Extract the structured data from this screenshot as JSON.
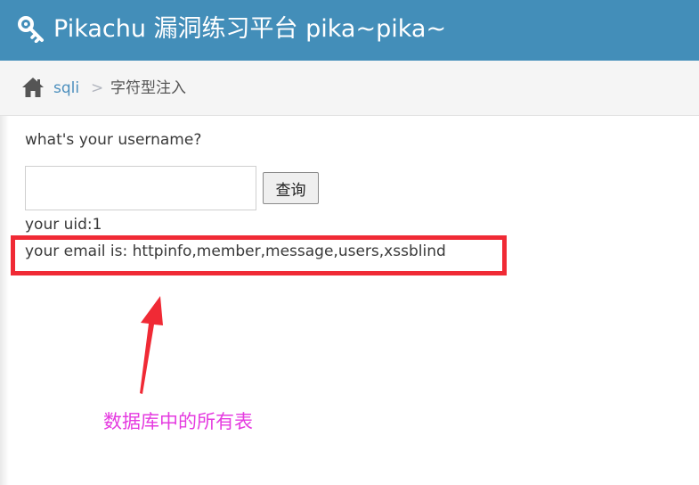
{
  "navbar": {
    "title": "Pikachu 漏洞练习平台 pika~pika~",
    "icon": "key-icon",
    "color": "#438eb9"
  },
  "breadcrumb": {
    "home_icon": "home-icon",
    "link": "sqli",
    "separator": ">",
    "current": "字符型注入"
  },
  "form": {
    "question": "what's your username?",
    "input_value": "",
    "submit_label": "查询"
  },
  "result": {
    "uid": "your uid:1",
    "email": "your email is: httpinfo,member,message,users,xssblind"
  },
  "annotation": {
    "text": "数据库中的所有表",
    "box_color": "#f02a35",
    "text_color": "#e53be0"
  }
}
